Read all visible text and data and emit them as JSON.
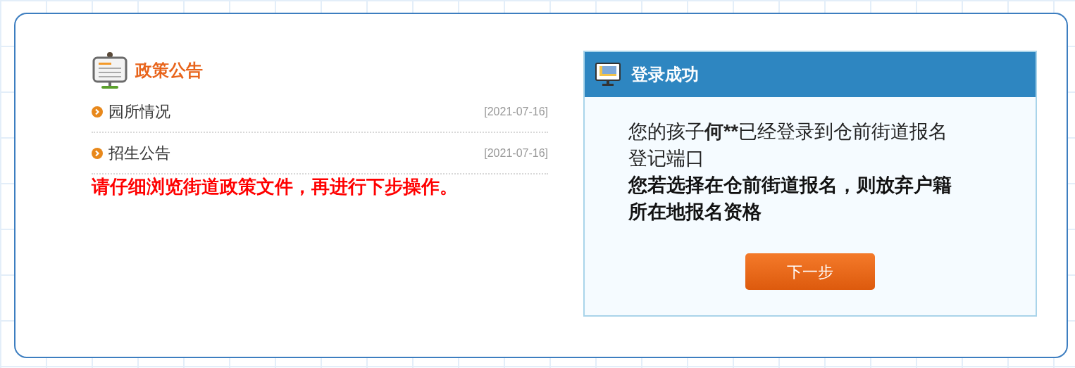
{
  "policy": {
    "title": "政策公告",
    "items": [
      {
        "title": "园所情况",
        "date": "[2021-07-16]"
      },
      {
        "title": "招生公告",
        "date": "[2021-07-16]"
      }
    ],
    "notice": "请仔细浏览街道政策文件，再进行下步操作。"
  },
  "login_panel": {
    "title": "登录成功",
    "message": [
      {
        "text": "您的孩子",
        "bold": false
      },
      {
        "text": "何**",
        "bold": true
      },
      {
        "text": "已经登录到仓前街道报名登记端口",
        "bold": false
      }
    ],
    "warning": "您若选择在仓前街道报名，则放弃户籍所在地报名资格",
    "button": "下一步"
  }
}
